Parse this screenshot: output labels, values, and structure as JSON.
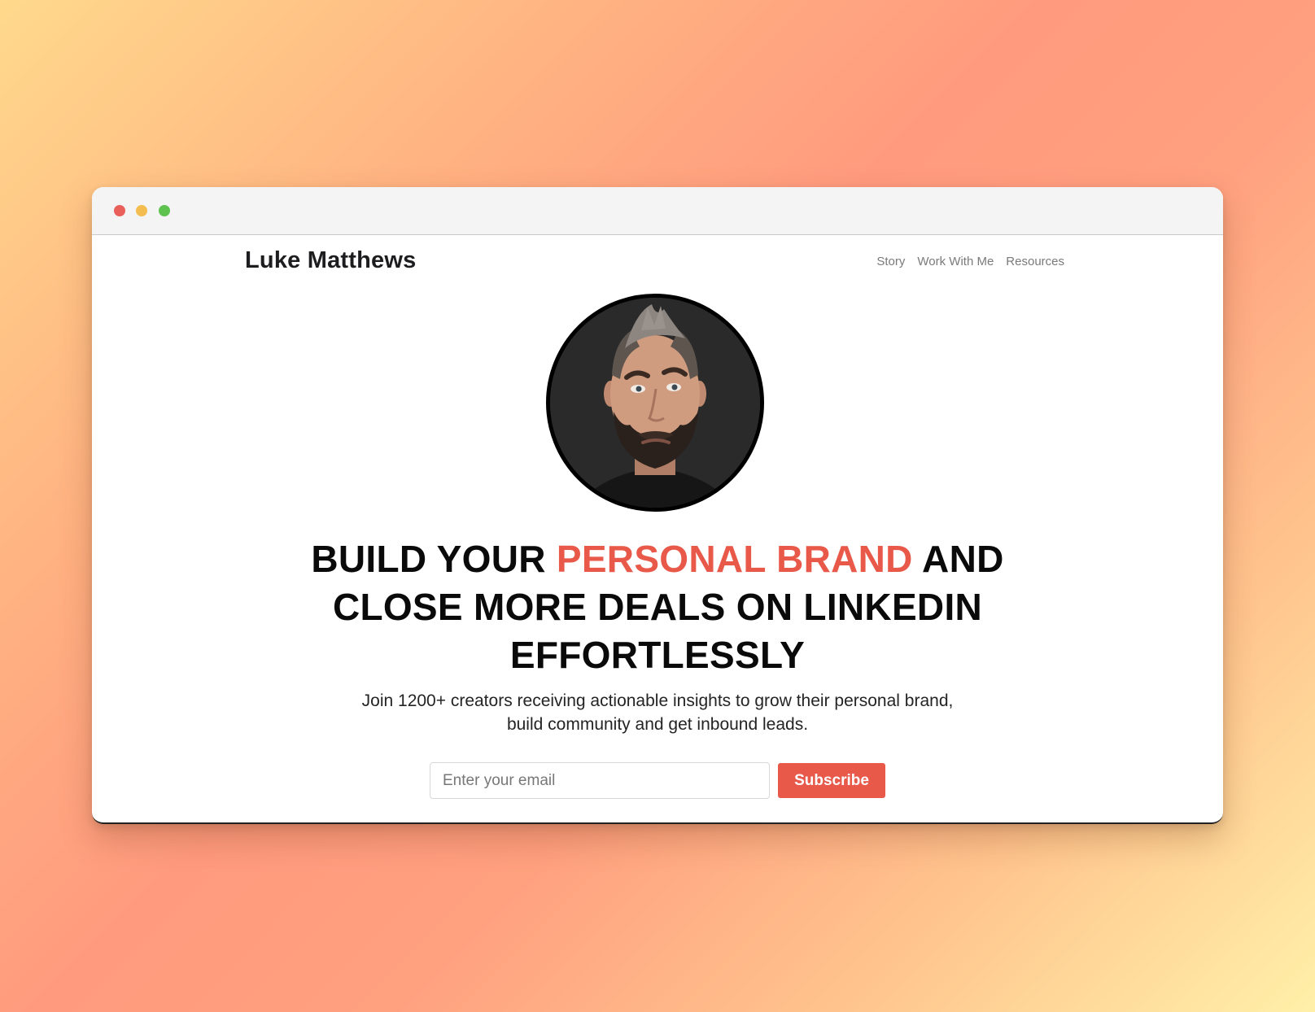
{
  "browser": {
    "traffic_lights": [
      "close",
      "minimize",
      "maximize"
    ]
  },
  "header": {
    "brand": "Luke Matthews",
    "nav": [
      "Story",
      "Work With Me",
      "Resources"
    ]
  },
  "hero": {
    "headline_part1": "BUILD YOUR ",
    "headline_accent": "PERSONAL BRAND",
    "headline_part2": " AND",
    "headline_line2": "CLOSE MORE DEALS ON LINKEDIN",
    "headline_line3": "EFFORTLESSLY",
    "subtext_line1": "Join 1200+ creators receiving actionable insights to grow their personal brand,",
    "subtext_line2": "build community and get inbound leads."
  },
  "signup": {
    "email_placeholder": "Enter your email",
    "button_label": "Subscribe"
  },
  "colors": {
    "accent": "#e8594a",
    "text_dark": "#0a0a0a",
    "nav_text": "#7a7a7a"
  }
}
